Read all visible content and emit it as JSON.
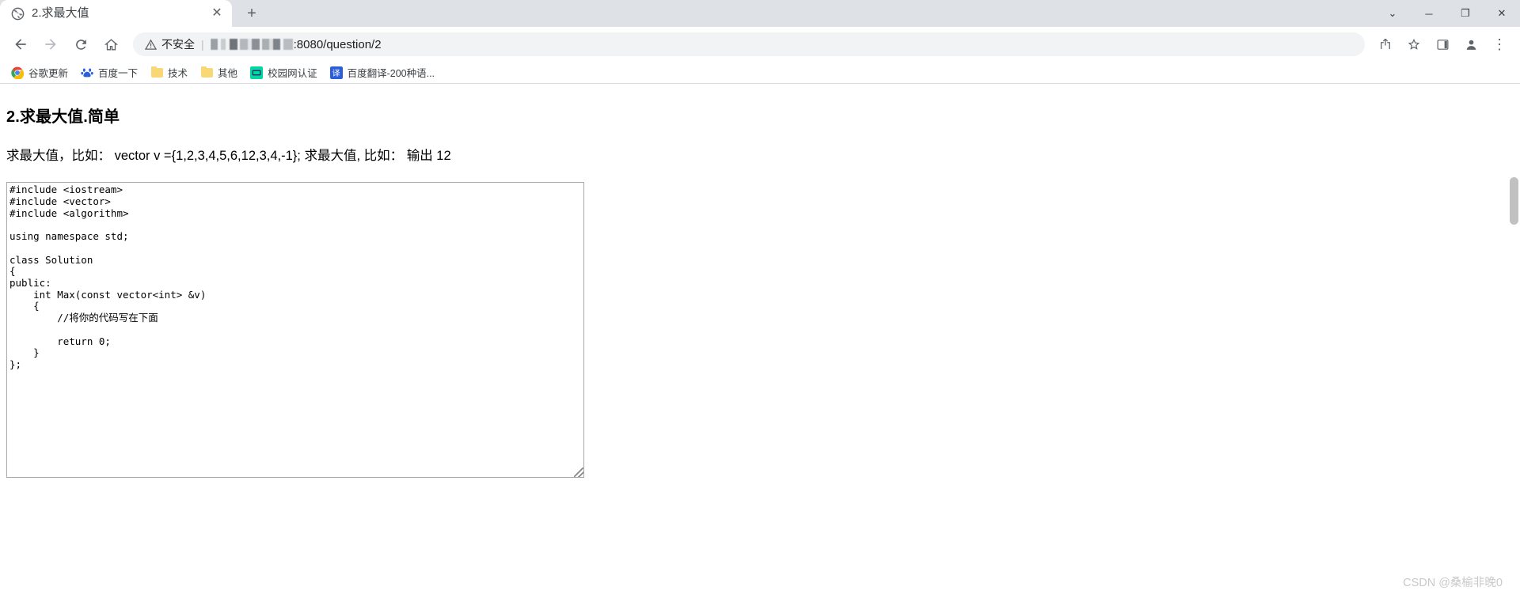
{
  "window": {
    "controls": {
      "minimize_label": "─",
      "maximize_label": "❐",
      "close_label": "✕",
      "tab_search_label": "⌄"
    }
  },
  "tabstrip": {
    "tabs": [
      {
        "title": "2.求最大值",
        "favicon": "globe-icon",
        "close_label": "✕",
        "active": true
      }
    ],
    "new_tab_label": "+"
  },
  "toolbar": {
    "back_label": "←",
    "forward_label": "→",
    "reload_label": "⟳",
    "home_label": "⌂",
    "security_icon": "warning-triangle-icon",
    "security_text": "不安全",
    "separator": "|",
    "url_redacted_host": "",
    "url_visible_tail": ":8080/question/2",
    "share_label": "share-icon",
    "bookmark_star_label": "☆",
    "sidepanel_label": "sidepanel-icon",
    "profile_label": "profile-avatar-icon",
    "menu_label": "⋮"
  },
  "bookmarks": [
    {
      "label": "谷歌更新",
      "icon": "chrome-logo-icon",
      "icon_type": "chrome"
    },
    {
      "label": "百度一下",
      "icon": "baidu-paw-icon",
      "icon_type": "baidu"
    },
    {
      "label": "技术",
      "icon": "folder-icon",
      "icon_type": "folder"
    },
    {
      "label": "其他",
      "icon": "folder-icon",
      "icon_type": "folder"
    },
    {
      "label": "校园网认证",
      "icon": "campus-network-icon",
      "icon_type": "campus"
    },
    {
      "label": "百度翻译-200种语...",
      "icon": "baidu-translate-icon",
      "icon_type": "translate",
      "icon_text": "译"
    }
  ],
  "page": {
    "title": "2.求最大值.简单",
    "description": "求最大值，比如： vector v ={1,2,3,4,5,6,12,3,4,-1}; 求最大值, 比如： 输出 12",
    "code_editor": {
      "name": "code-textarea",
      "value": "#include <iostream>\n#include <vector>\n#include <algorithm>\n\nusing namespace std;\n\nclass Solution\n{\npublic:\n    int Max(const vector<int> &v)\n    {\n        //将你的代码写在下面\n\n        return 0;\n    }\n};",
      "placeholder": ""
    },
    "watermark": "CSDN @桑榆非晚0"
  },
  "colors": {
    "chrome_tabstrip_bg": "#dee1e6",
    "omnibox_bg": "#f1f3f4",
    "text_primary": "#202124",
    "text_secondary": "#5f6368",
    "accent_blue": "#1a73e8",
    "folder_yellow": "#f8d775",
    "watermark_gray": "#c9c9c9",
    "scrollbar_thumb": "#c1c1c1"
  }
}
